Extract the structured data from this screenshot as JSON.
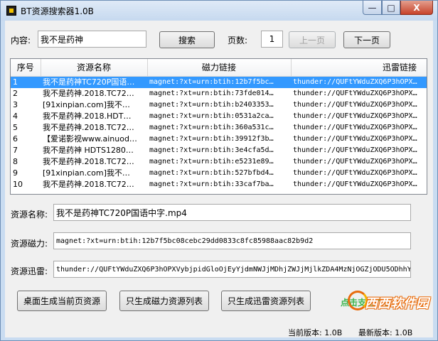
{
  "window": {
    "title": "BT资源搜索器1.0B",
    "min_label": "—",
    "max_label": "□",
    "close_label": "X"
  },
  "search": {
    "label": "内容:",
    "value": "我不是药神",
    "search_button": "搜索",
    "page_label": "页数:",
    "page_value": "1",
    "prev_button": "上一页",
    "next_button": "下一页"
  },
  "table": {
    "columns": [
      "序号",
      "资源名称",
      "磁力链接",
      "迅雷链接"
    ],
    "rows": [
      {
        "no": "1",
        "name": "我不是药神TC720P国语…",
        "magnet": "magnet:?xt=urn:btih:12b7f5bc…",
        "thunder": "thunder://QUFtYWduZXQ6P3hOPX…"
      },
      {
        "no": "2",
        "name": "我不是药神.2018.TC72…",
        "magnet": "magnet:?xt=urn:btih:73fde014…",
        "thunder": "thunder://QUFtYWduZXQ6P3hOPX…"
      },
      {
        "no": "3",
        "name": "[91xinpian.com]我不…",
        "magnet": "magnet:?xt=urn:btih:b2403353…",
        "thunder": "thunder://QUFtYWduZXQ6P3hOPX…"
      },
      {
        "no": "4",
        "name": "我不是药神.2018.HDT…",
        "magnet": "magnet:?xt=urn:btih:0531a2ca…",
        "thunder": "thunder://QUFtYWduZXQ6P3hOPX…"
      },
      {
        "no": "5",
        "name": "我不是药神.2018.TC72…",
        "magnet": "magnet:?xt=urn:btih:360a531c…",
        "thunder": "thunder://QUFtYWduZXQ6P3hOPX…"
      },
      {
        "no": "6",
        "name": "【爱诺影视www.ainuod…",
        "magnet": "magnet:?xt=urn:btih:39912f3b…",
        "thunder": "thunder://QUFtYWduZXQ6P3hOPX…"
      },
      {
        "no": "7",
        "name": "我不是药神 HDTS1280…",
        "magnet": "magnet:?xt=urn:btih:3e4cfa5d…",
        "thunder": "thunder://QUFtYWduZXQ6P3hOPX…"
      },
      {
        "no": "8",
        "name": "我不是药神.2018.TC72…",
        "magnet": "magnet:?xt=urn:btih:e5231e89…",
        "thunder": "thunder://QUFtYWduZXQ6P3hOPX…"
      },
      {
        "no": "9",
        "name": "[91xinpian.com]我不…",
        "magnet": "magnet:?xt=urn:btih:527bfbd4…",
        "thunder": "thunder://QUFtYWduZXQ6P3hOPX…"
      },
      {
        "no": "10",
        "name": "我不是药神.2018.TC72…",
        "magnet": "magnet:?xt=urn:btih:33caf7ba…",
        "thunder": "thunder://QUFtYWduZXQ6P3hOPX…"
      }
    ]
  },
  "details": {
    "name_label": "资源名称:",
    "name_value": "我不是药神TC720P国语中字.mp4",
    "magnet_label": "资源磁力:",
    "magnet_value": "magnet:?xt=urn:btih:12b7f5bc08cebc29dd0833c8fc85988aac82b9d2",
    "thunder_label": "资源迅雷:",
    "thunder_value": "thunder://QUFtYWduZXQ6P3hOPXVybjpidGloOjEyYjdmNWJjMDhjZWJjMjlkZDA4MzNjOGZjODU5ODhhY"
  },
  "actions": {
    "gen_page": "桌面生成当前页资源",
    "gen_magnet": "只生成磁力资源列表",
    "gen_thunder": "只生成迅雷资源列表",
    "support": "点击支持作者!"
  },
  "footer": {
    "current_version": "当前版本: 1.0B",
    "latest_version": "最新版本: 1.0B",
    "watermark": "西西软件园"
  },
  "colors": {
    "selection": "#3399ff",
    "support_green": "#39b44a"
  }
}
